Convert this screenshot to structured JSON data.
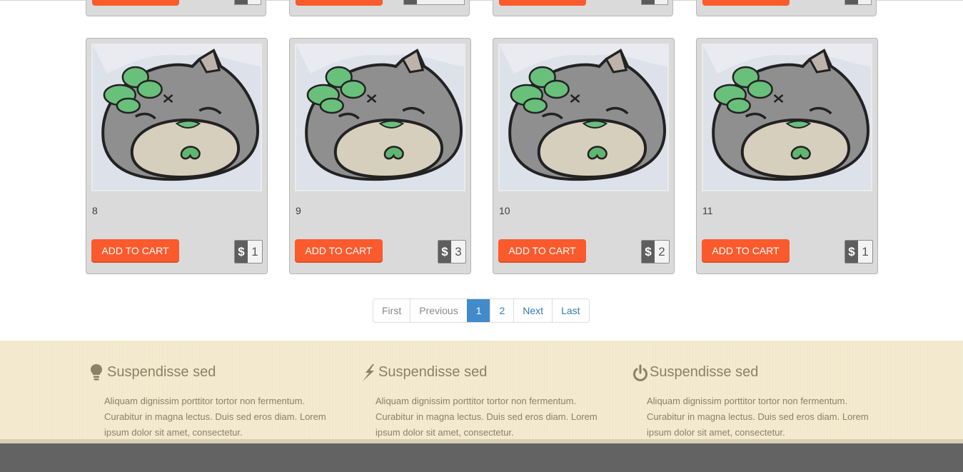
{
  "cart_label": "ADD TO CART",
  "currency_symbol": "$",
  "products": [
    {
      "number": "8",
      "qty": "1"
    },
    {
      "number": "9",
      "qty": "3"
    },
    {
      "number": "10",
      "qty": "2"
    },
    {
      "number": "11",
      "qty": "1"
    }
  ],
  "pagination": {
    "items": [
      "First",
      "Previous",
      "1",
      "2",
      "Next",
      "Last"
    ],
    "active": "1"
  },
  "features": [
    {
      "icon": "lightbulb-icon",
      "title": "Suspendisse sed",
      "text": "Aliquam dignissim porttitor tortor non fermentum. Curabitur in magna lectus. Duis sed eros diam. Lorem ipsum dolor sit amet, consectetur."
    },
    {
      "icon": "bolt-icon",
      "title": "Suspendisse sed",
      "text": "Aliquam dignissim porttitor tortor non fermentum. Curabitur in magna lectus. Duis sed eros diam. Lorem ipsum dolor sit amet, consectetur."
    },
    {
      "icon": "power-icon",
      "title": "Suspendisse sed",
      "text": "Aliquam dignissim porttitor tortor non fermentum. Curabitur in magna lectus. Duis sed eros diam. Lorem ipsum dolor sit amet, consectetur."
    }
  ],
  "colors": {
    "button": "#fb5a2d",
    "pagination_active": "#428bca",
    "features_bg": "#f2e8cc",
    "footer_bg": "#636363"
  }
}
